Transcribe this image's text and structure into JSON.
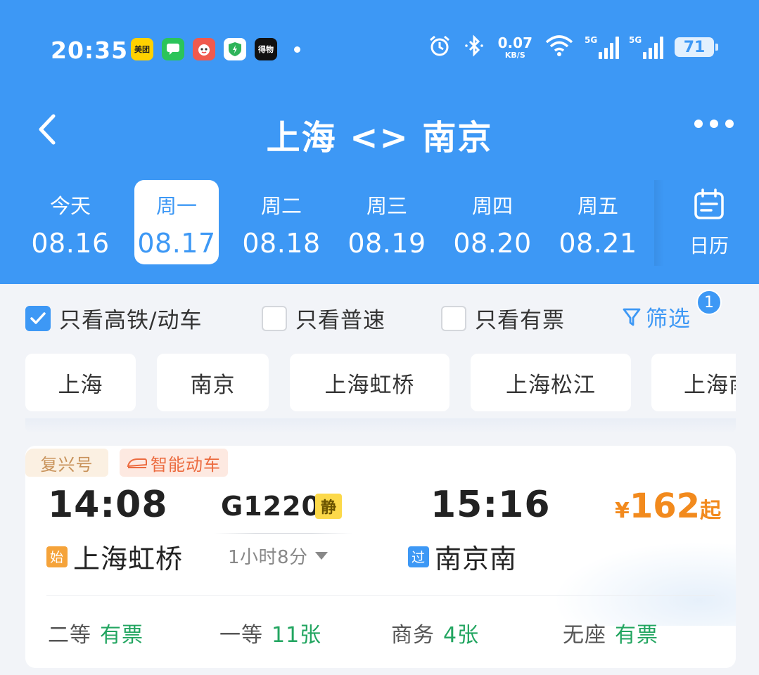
{
  "status_bar": {
    "time": "20:35",
    "app_icons": [
      {
        "name": "meituan-icon",
        "text": "美团"
      },
      {
        "name": "messages-icon",
        "text": ""
      },
      {
        "name": "game-app-icon",
        "text": ""
      },
      {
        "name": "security-shield-icon",
        "text": ""
      },
      {
        "name": "dewu-icon",
        "text": "得物"
      }
    ],
    "net_speed_value": "0.07",
    "net_speed_unit": "KB/S",
    "signal_1_label": "5G",
    "signal_2_label": "5G",
    "battery": "71"
  },
  "nav": {
    "title": "上海 <> 南京"
  },
  "date_tabs": [
    {
      "weekday": "今天",
      "date": "08.16",
      "active": false
    },
    {
      "weekday": "周一",
      "date": "08.17",
      "active": true
    },
    {
      "weekday": "周二",
      "date": "08.18",
      "active": false
    },
    {
      "weekday": "周三",
      "date": "08.19",
      "active": false
    },
    {
      "weekday": "周四",
      "date": "08.20",
      "active": false
    },
    {
      "weekday": "周五",
      "date": "08.21",
      "active": false
    }
  ],
  "calendar": {
    "label": "日历"
  },
  "filters": {
    "high_speed_only": {
      "label": "只看高铁/动车",
      "checked": true
    },
    "normal_only": {
      "label": "只看普速",
      "checked": false
    },
    "available_only": {
      "label": "只看有票",
      "checked": false
    },
    "filter_label": "筛选",
    "filter_count": "1"
  },
  "stations": [
    "上海",
    "南京",
    "上海虹桥",
    "上海松江",
    "上海南"
  ],
  "train": {
    "tags": [
      "复兴号",
      "智能动车"
    ],
    "departure_time": "14:08",
    "departure_station": "上海虹桥",
    "departure_badge": "始",
    "train_number": "G1220",
    "quiet_badge": "静",
    "duration": "1小时8分",
    "arrival_time": "15:16",
    "arrival_station": "南京南",
    "arrival_badge": "过",
    "price_currency": "¥",
    "price_amount": "162",
    "price_suffix": "起",
    "seats": [
      {
        "type": "二等",
        "availability": "有票"
      },
      {
        "type": "一等",
        "availability": "11张"
      },
      {
        "type": "商务",
        "availability": "4张"
      },
      {
        "type": "无座",
        "availability": "有票"
      }
    ]
  },
  "colors": {
    "header_blue": "#3d98f5",
    "price_orange": "#f28a1d",
    "available_green": "#22a560"
  }
}
